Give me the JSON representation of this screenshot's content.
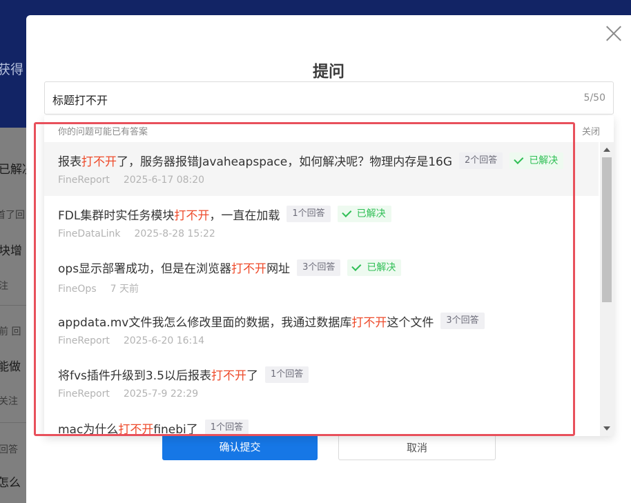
{
  "background": {
    "banner_text": "获得",
    "rows": [
      {
        "text": "已解决",
        "style": "normal"
      },
      {
        "text": "首了回",
        "style": "small"
      },
      {
        "text": "块增",
        "style": "normal"
      },
      {
        "text": "注",
        "style": "small"
      },
      {
        "text": "前 回",
        "style": "small"
      },
      {
        "text": "能做",
        "style": "normal"
      },
      {
        "text": "关注",
        "style": "small"
      },
      {
        "text": "回答",
        "style": "small"
      },
      {
        "text": "怎么",
        "style": "normal"
      }
    ]
  },
  "modal": {
    "title": "提问",
    "title_input": {
      "value": "标题打不开",
      "counter": "5/50"
    },
    "primary_button": "确认提交",
    "secondary_button": "取消"
  },
  "suggestions": {
    "header": "你的问题可能已有答案",
    "close_label": "关闭",
    "items": [
      {
        "parts": [
          "报表",
          "打不开",
          "了，服务器报错Javaheapspace，如何解决呢？物理内存是16G"
        ],
        "answers": "2个回答",
        "solved": "已解决",
        "product": "FineReport",
        "date": "2025-6-17 08:20",
        "hover": true
      },
      {
        "parts": [
          "FDL集群时实任务模块",
          "打不开",
          "，一直在加载"
        ],
        "answers": "1个回答",
        "solved": "已解决",
        "product": "FineDataLink",
        "date": "2025-8-28 15:22",
        "hover": false
      },
      {
        "parts": [
          "ops显示部署成功，但是在浏览器",
          "打不开",
          "网址"
        ],
        "answers": "3个回答",
        "solved": "已解决",
        "product": "FineOps",
        "date": "7 天前",
        "hover": false
      },
      {
        "parts": [
          "appdata.mv文件我怎么修改里面的数据，我通过数据库",
          "打不开",
          "这个文件"
        ],
        "answers": "3个回答",
        "solved": "",
        "product": "FineReport",
        "date": "2025-6-20 16:14",
        "hover": false
      },
      {
        "parts": [
          "将fvs插件升级到3.5以后报表",
          "打不开",
          "了"
        ],
        "answers": "1个回答",
        "solved": "",
        "product": "FineReport",
        "date": "2025-7-9 22:29",
        "hover": false
      },
      {
        "parts": [
          "mac为什么",
          "打不开",
          "finebi了"
        ],
        "answers": "1个回答",
        "solved": "",
        "product": "",
        "date": "",
        "hover": false
      }
    ]
  },
  "colors": {
    "highlight": "#ee4b2b",
    "solved": "#2fbf55",
    "primary": "#1677e6",
    "annotation_box": "#e8505b"
  }
}
